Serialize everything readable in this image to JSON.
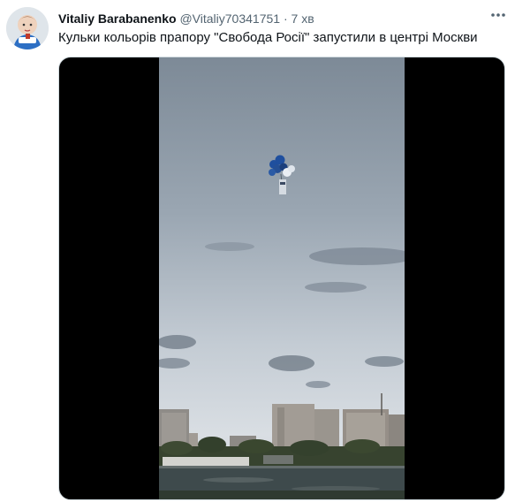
{
  "tweet": {
    "author": {
      "display_name": "Vitaliy Barabanenko",
      "handle": "@Vitaliy70341751",
      "avatar_icon": "profile-photo-icon"
    },
    "separator": "·",
    "timestamp": "7 хв",
    "text": "Кульки кольорів прапору \"Свобода Росії\" запустили в центрі Москви",
    "more_icon": "more-options-icon",
    "media": {
      "type": "video",
      "content": "balloons-over-moscow-skyline"
    }
  },
  "colors": {
    "text_primary": "#0f1419",
    "text_secondary": "#536471",
    "media_background": "#000000",
    "balloon_blue": "#1f4f9e",
    "balloon_white": "#e9eef4"
  }
}
